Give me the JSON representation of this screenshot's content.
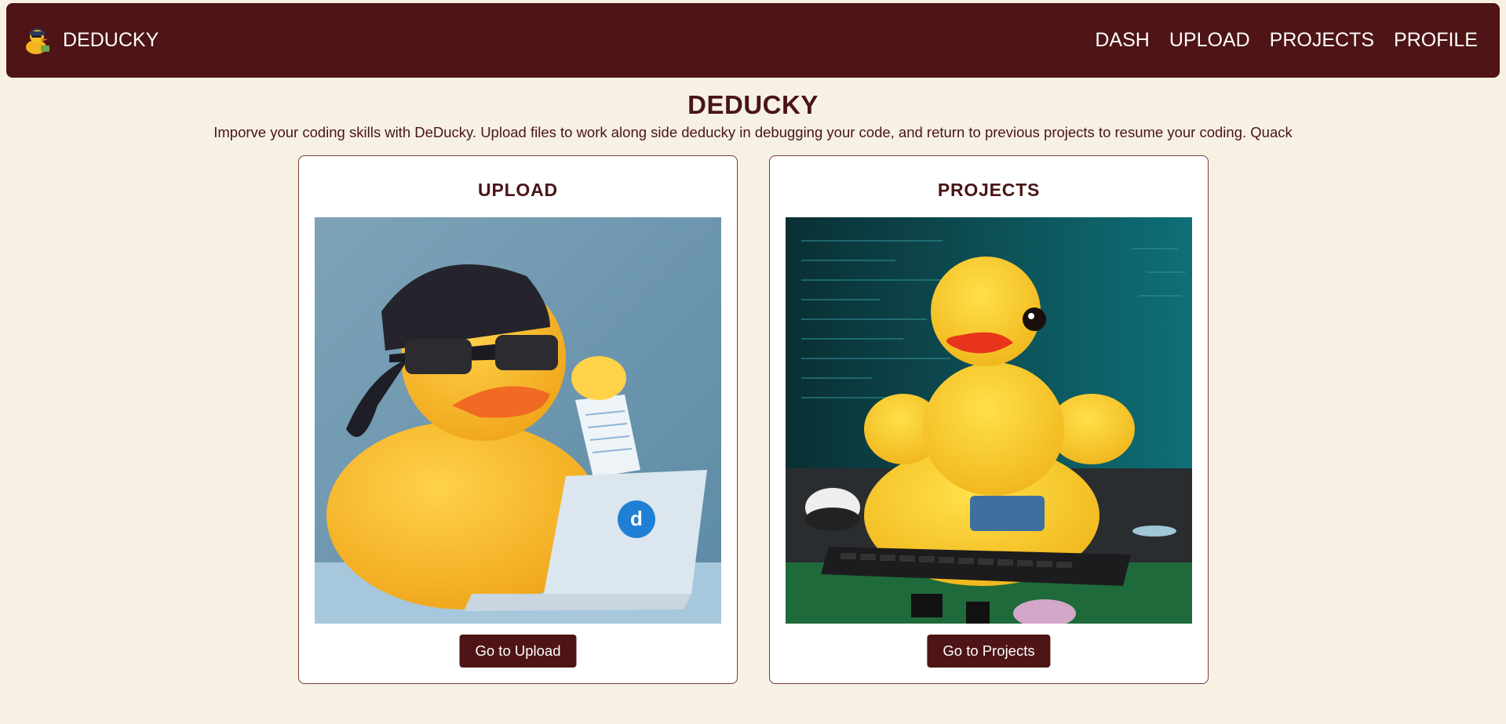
{
  "navbar": {
    "brand": "DEDUCKY",
    "logo_icon": "cool-duck-logo-icon",
    "links": [
      {
        "label": "DASH"
      },
      {
        "label": "UPLOAD"
      },
      {
        "label": "PROJECTS"
      },
      {
        "label": "PROFILE"
      }
    ]
  },
  "hero": {
    "title": "DEDUCKY",
    "description": "Imporve your coding skills with DeDucky. Upload files to work along side deducky in debugging your code, and return to previous projects to resume your coding. Quack"
  },
  "cards": [
    {
      "title": "UPLOAD",
      "image": "duck-with-laptop-image",
      "button": "Go to Upload"
    },
    {
      "title": "PROJECTS",
      "image": "muscular-duck-keyboard-image",
      "button": "Go to Projects"
    }
  ],
  "colors": {
    "primary": "#4e1416",
    "background": "#f6f1e3",
    "card_bg": "#ffffff"
  }
}
